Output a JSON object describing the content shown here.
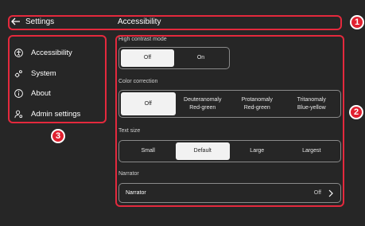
{
  "header": {
    "back_label": "Settings",
    "page_title": "Accessibility"
  },
  "sidebar": {
    "items": [
      {
        "label": "Accessibility",
        "icon": "accessibility-icon"
      },
      {
        "label": "System",
        "icon": "gears-icon"
      },
      {
        "label": "About",
        "icon": "info-icon"
      },
      {
        "label": "Admin settings",
        "icon": "admin-user-icon"
      }
    ]
  },
  "main": {
    "high_contrast": {
      "label": "High contrast mode",
      "options": [
        "Off",
        "On"
      ],
      "selected": "Off"
    },
    "color_correction": {
      "label": "Color correction",
      "options": [
        {
          "line1": "Off",
          "line2": ""
        },
        {
          "line1": "Deuteranomaly",
          "line2": "Red-green"
        },
        {
          "line1": "Protanomaly",
          "line2": "Red-green"
        },
        {
          "line1": "Tritanomaly",
          "line2": "Blue-yellow"
        }
      ],
      "selected": "Off"
    },
    "text_size": {
      "label": "Text size",
      "options": [
        "Small",
        "Default",
        "Large",
        "Largest"
      ],
      "selected": "Default"
    },
    "narrator": {
      "section_label": "Narrator",
      "row_label": "Narrator",
      "value": "Off"
    }
  },
  "callouts": [
    "1",
    "2",
    "3"
  ],
  "colors": {
    "background": "#262626",
    "callout": "#e4293d",
    "selected": "#f2f2f2"
  }
}
